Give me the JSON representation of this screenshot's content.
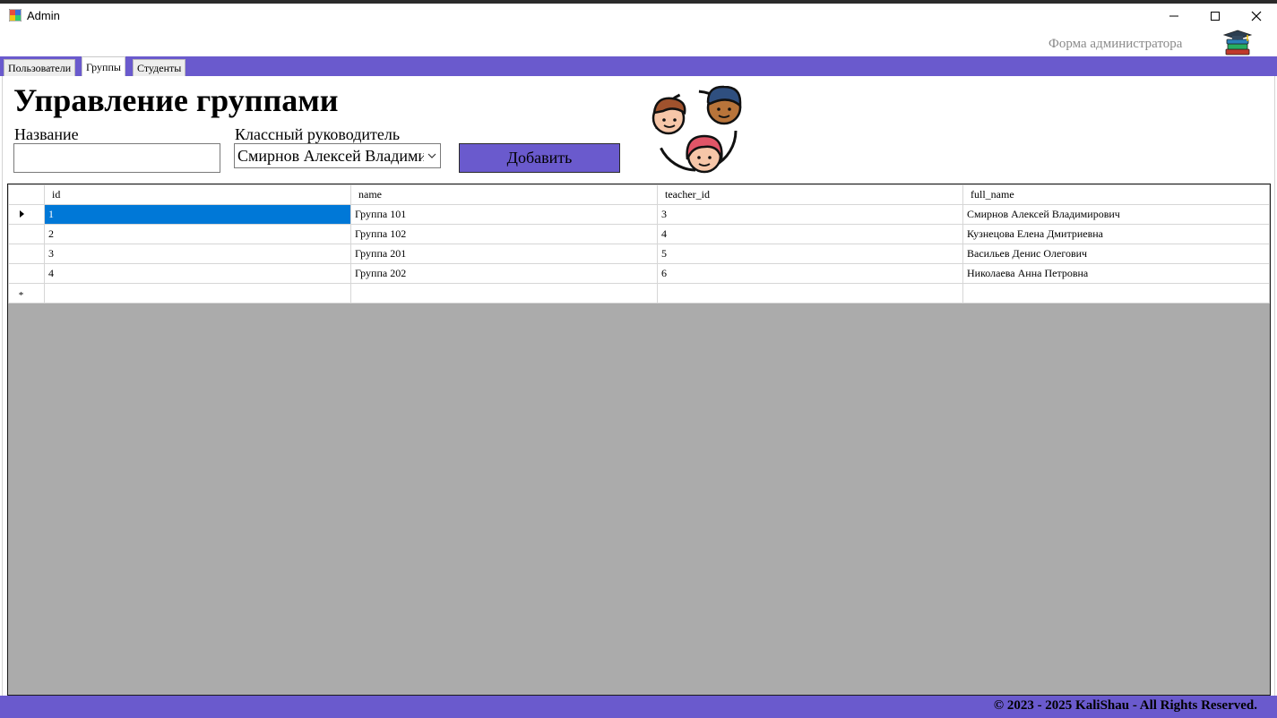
{
  "window": {
    "title": "Admin",
    "minimize_icon": "minimize-icon",
    "maximize_icon": "maximize-icon",
    "close_icon": "close-icon"
  },
  "header": {
    "form_label": "Форма администратора",
    "logo_icon": "books-graduation-cap-icon"
  },
  "tabs": [
    {
      "label": "Пользователи",
      "active": false
    },
    {
      "label": "Группы",
      "active": true
    },
    {
      "label": "Студенты",
      "active": false
    }
  ],
  "groups_page": {
    "title": "Управление группами",
    "name_label": "Название",
    "name_value": "",
    "teacher_label": "Классный руководитель",
    "teacher_value": "Смирнов Алексей Владимирович",
    "add_button": "Добавить",
    "illustration_icon": "people-group-icon"
  },
  "grid": {
    "columns": [
      "id",
      "name",
      "teacher_id",
      "full_name"
    ],
    "rows": [
      [
        "1",
        "Группа 101",
        "3",
        "Смирнов Алексей Владимирович"
      ],
      [
        "2",
        "Группа 102",
        "4",
        "Кузнецова Елена Дмитриевна"
      ],
      [
        "3",
        "Группа 201",
        "5",
        "Васильев Денис Олегович"
      ],
      [
        "4",
        "Группа 202",
        "6",
        "Николаева Анна Петровна"
      ]
    ],
    "new_row_marker": "*",
    "selected_row": 0,
    "selected_column": 0
  },
  "footer": {
    "text": "© 2023 - 2025 KaliShau - All Rights Reserved."
  },
  "colors": {
    "accent": "#6a5acd",
    "selection": "#0078d7",
    "grid_background": "#ababab"
  }
}
